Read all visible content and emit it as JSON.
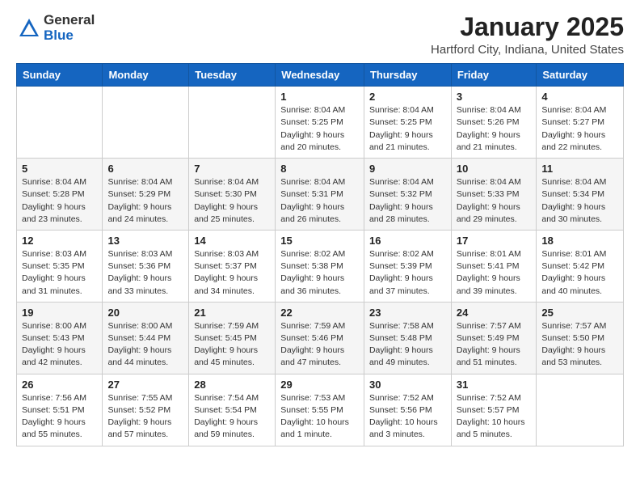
{
  "header": {
    "logo_general": "General",
    "logo_blue": "Blue",
    "month_title": "January 2025",
    "location": "Hartford City, Indiana, United States"
  },
  "days_of_week": [
    "Sunday",
    "Monday",
    "Tuesday",
    "Wednesday",
    "Thursday",
    "Friday",
    "Saturday"
  ],
  "weeks": [
    [
      {
        "day": "",
        "info": ""
      },
      {
        "day": "",
        "info": ""
      },
      {
        "day": "",
        "info": ""
      },
      {
        "day": "1",
        "info": "Sunrise: 8:04 AM\nSunset: 5:25 PM\nDaylight: 9 hours\nand 20 minutes."
      },
      {
        "day": "2",
        "info": "Sunrise: 8:04 AM\nSunset: 5:25 PM\nDaylight: 9 hours\nand 21 minutes."
      },
      {
        "day": "3",
        "info": "Sunrise: 8:04 AM\nSunset: 5:26 PM\nDaylight: 9 hours\nand 21 minutes."
      },
      {
        "day": "4",
        "info": "Sunrise: 8:04 AM\nSunset: 5:27 PM\nDaylight: 9 hours\nand 22 minutes."
      }
    ],
    [
      {
        "day": "5",
        "info": "Sunrise: 8:04 AM\nSunset: 5:28 PM\nDaylight: 9 hours\nand 23 minutes."
      },
      {
        "day": "6",
        "info": "Sunrise: 8:04 AM\nSunset: 5:29 PM\nDaylight: 9 hours\nand 24 minutes."
      },
      {
        "day": "7",
        "info": "Sunrise: 8:04 AM\nSunset: 5:30 PM\nDaylight: 9 hours\nand 25 minutes."
      },
      {
        "day": "8",
        "info": "Sunrise: 8:04 AM\nSunset: 5:31 PM\nDaylight: 9 hours\nand 26 minutes."
      },
      {
        "day": "9",
        "info": "Sunrise: 8:04 AM\nSunset: 5:32 PM\nDaylight: 9 hours\nand 28 minutes."
      },
      {
        "day": "10",
        "info": "Sunrise: 8:04 AM\nSunset: 5:33 PM\nDaylight: 9 hours\nand 29 minutes."
      },
      {
        "day": "11",
        "info": "Sunrise: 8:04 AM\nSunset: 5:34 PM\nDaylight: 9 hours\nand 30 minutes."
      }
    ],
    [
      {
        "day": "12",
        "info": "Sunrise: 8:03 AM\nSunset: 5:35 PM\nDaylight: 9 hours\nand 31 minutes."
      },
      {
        "day": "13",
        "info": "Sunrise: 8:03 AM\nSunset: 5:36 PM\nDaylight: 9 hours\nand 33 minutes."
      },
      {
        "day": "14",
        "info": "Sunrise: 8:03 AM\nSunset: 5:37 PM\nDaylight: 9 hours\nand 34 minutes."
      },
      {
        "day": "15",
        "info": "Sunrise: 8:02 AM\nSunset: 5:38 PM\nDaylight: 9 hours\nand 36 minutes."
      },
      {
        "day": "16",
        "info": "Sunrise: 8:02 AM\nSunset: 5:39 PM\nDaylight: 9 hours\nand 37 minutes."
      },
      {
        "day": "17",
        "info": "Sunrise: 8:01 AM\nSunset: 5:41 PM\nDaylight: 9 hours\nand 39 minutes."
      },
      {
        "day": "18",
        "info": "Sunrise: 8:01 AM\nSunset: 5:42 PM\nDaylight: 9 hours\nand 40 minutes."
      }
    ],
    [
      {
        "day": "19",
        "info": "Sunrise: 8:00 AM\nSunset: 5:43 PM\nDaylight: 9 hours\nand 42 minutes."
      },
      {
        "day": "20",
        "info": "Sunrise: 8:00 AM\nSunset: 5:44 PM\nDaylight: 9 hours\nand 44 minutes."
      },
      {
        "day": "21",
        "info": "Sunrise: 7:59 AM\nSunset: 5:45 PM\nDaylight: 9 hours\nand 45 minutes."
      },
      {
        "day": "22",
        "info": "Sunrise: 7:59 AM\nSunset: 5:46 PM\nDaylight: 9 hours\nand 47 minutes."
      },
      {
        "day": "23",
        "info": "Sunrise: 7:58 AM\nSunset: 5:48 PM\nDaylight: 9 hours\nand 49 minutes."
      },
      {
        "day": "24",
        "info": "Sunrise: 7:57 AM\nSunset: 5:49 PM\nDaylight: 9 hours\nand 51 minutes."
      },
      {
        "day": "25",
        "info": "Sunrise: 7:57 AM\nSunset: 5:50 PM\nDaylight: 9 hours\nand 53 minutes."
      }
    ],
    [
      {
        "day": "26",
        "info": "Sunrise: 7:56 AM\nSunset: 5:51 PM\nDaylight: 9 hours\nand 55 minutes."
      },
      {
        "day": "27",
        "info": "Sunrise: 7:55 AM\nSunset: 5:52 PM\nDaylight: 9 hours\nand 57 minutes."
      },
      {
        "day": "28",
        "info": "Sunrise: 7:54 AM\nSunset: 5:54 PM\nDaylight: 9 hours\nand 59 minutes."
      },
      {
        "day": "29",
        "info": "Sunrise: 7:53 AM\nSunset: 5:55 PM\nDaylight: 10 hours\nand 1 minute."
      },
      {
        "day": "30",
        "info": "Sunrise: 7:52 AM\nSunset: 5:56 PM\nDaylight: 10 hours\nand 3 minutes."
      },
      {
        "day": "31",
        "info": "Sunrise: 7:52 AM\nSunset: 5:57 PM\nDaylight: 10 hours\nand 5 minutes."
      },
      {
        "day": "",
        "info": ""
      }
    ]
  ]
}
